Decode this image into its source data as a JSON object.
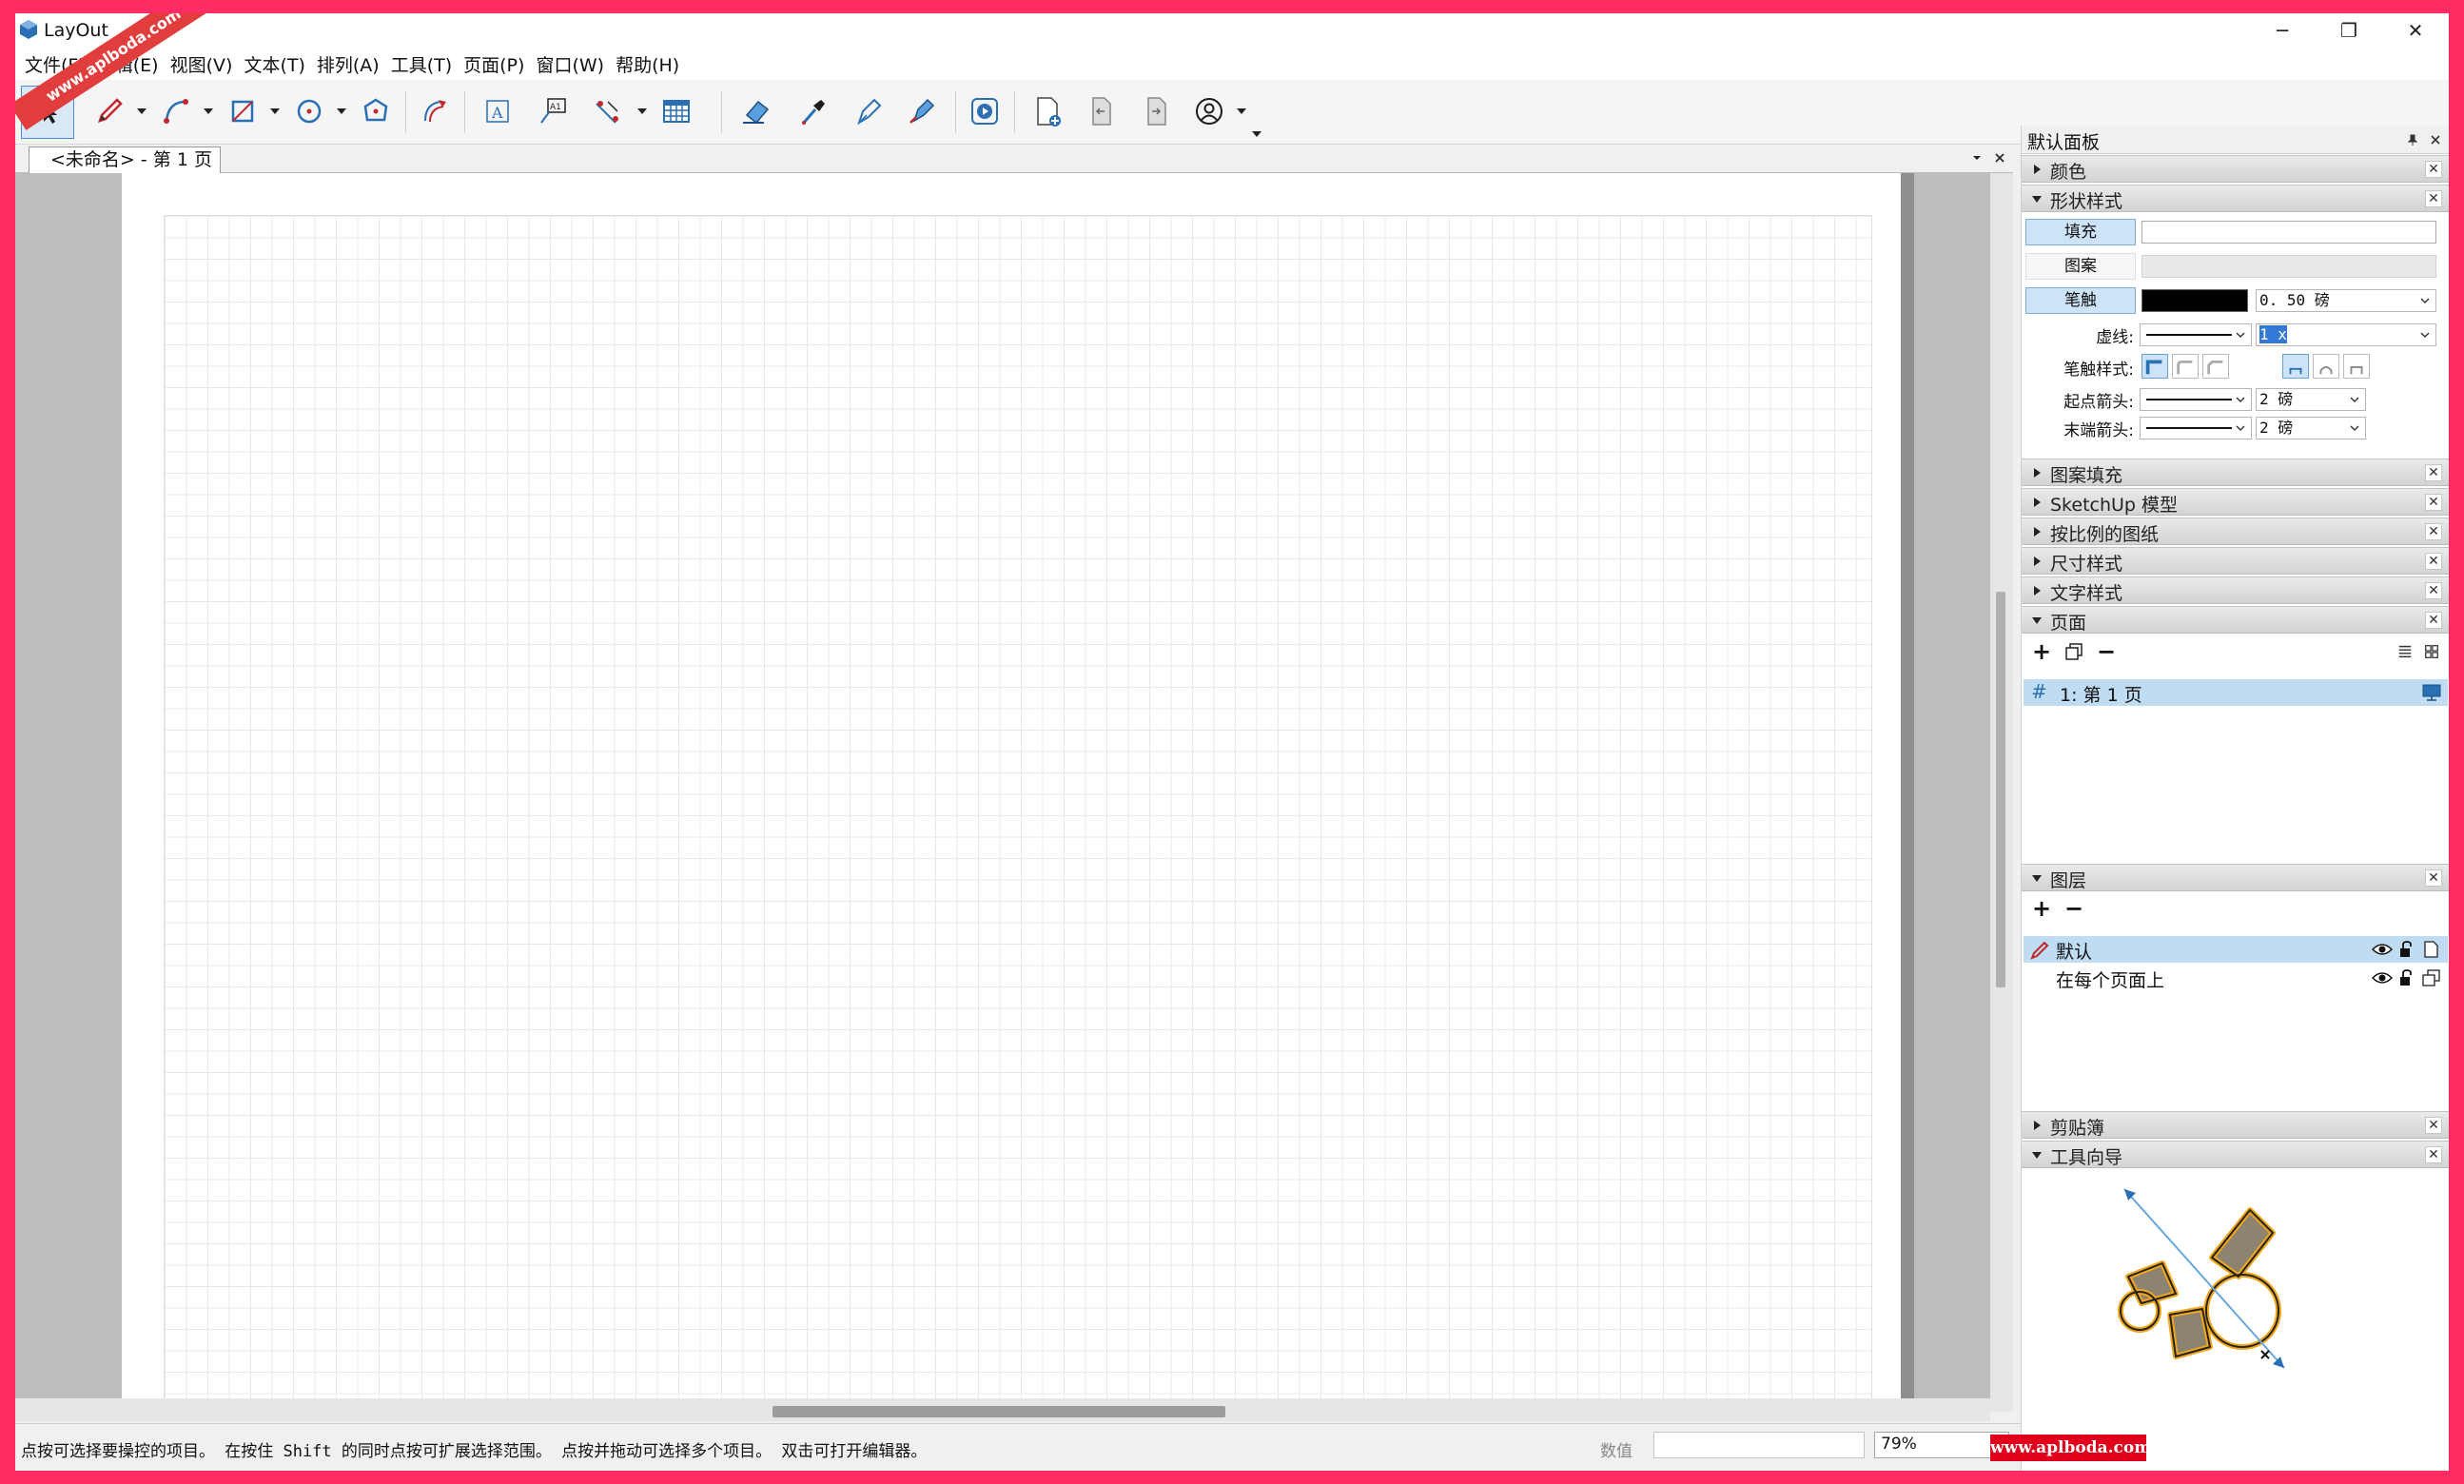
{
  "app": {
    "title": "LayOut"
  },
  "window_controls": {
    "minimize": "─",
    "restore": "❐",
    "close": "✕"
  },
  "menu": [
    "文件(F)",
    "编辑(E)",
    "视图(V)",
    "文本(T)",
    "排列(A)",
    "工具(T)",
    "页面(P)",
    "窗口(W)",
    "帮助(H)"
  ],
  "toolbar": {
    "tools": [
      "select-tool",
      "pencil-tool",
      "arc-tool",
      "rectangle-tool",
      "circle-tool",
      "polygon-tool",
      "offset-tool",
      "text-tool",
      "label-tool",
      "dimension-tool",
      "table-tool",
      "eraser-tool",
      "style-tool",
      "split-tool",
      "join-tool",
      "presentation-tool",
      "add-page-tool",
      "previous-page-tool",
      "next-page-tool",
      "account-tool"
    ]
  },
  "document_tab": {
    "label": "<未命名> - 第 1 页"
  },
  "status": {
    "hint": "点按可选择要操控的项目。 在按住 Shift 的同时点按可扩展选择范围。 点按并拖动可选择多个项目。 双击可打开编辑器。",
    "value_label": "数值",
    "value": "",
    "zoom": "79%"
  },
  "panel": {
    "title": "默认面板",
    "sections": {
      "color": "颜色",
      "shape_style": "形状样式",
      "pattern_fill": "图案填充",
      "sketchup_model": "SketchUp 模型",
      "scaled_drawing": "按比例的图纸",
      "dimension_style": "尺寸样式",
      "text_style": "文字样式",
      "pages": "页面",
      "layers": "图层",
      "scrapbooks": "剪贴簿",
      "instructor": "工具向导"
    },
    "shape_style": {
      "fill_label": "填充",
      "pattern_label": "图案",
      "stroke_label": "笔触",
      "stroke_weight": "0. 50 磅",
      "dash_label": "虚线:",
      "dash_scale": "1 x",
      "stroke_style_label": "笔触样式:",
      "start_arrow_label": "起点箭头:",
      "start_arrow_size": "2 磅",
      "end_arrow_label": "末端箭头:",
      "end_arrow_size": "2 磅"
    },
    "pages": {
      "items": [
        {
          "label": "1: 第 1 页"
        }
      ]
    },
    "layers": {
      "items": [
        {
          "label": "默认"
        },
        {
          "label": "在每个页面上"
        }
      ]
    }
  },
  "watermarks": {
    "top_left": "www.aplboda.com",
    "bottom_right": "www.aplboda.com"
  },
  "colors": {
    "accent": "#cde3f7",
    "frame": "#ff2d63"
  }
}
